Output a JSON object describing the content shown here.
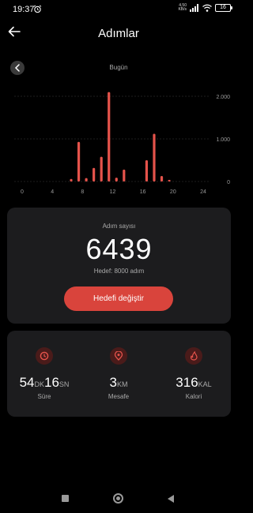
{
  "status_bar": {
    "time": "19:37",
    "net_speed": "4,50 KB/s",
    "battery": "16"
  },
  "header": {
    "title": "Adımlar"
  },
  "chart_nav": {
    "day_label": "Bugün"
  },
  "chart_data": {
    "type": "bar",
    "title": "",
    "x": [
      6,
      7,
      8,
      9,
      10,
      11,
      12,
      13,
      16,
      17,
      18,
      19
    ],
    "values": [
      60,
      930,
      80,
      320,
      580,
      2100,
      90,
      280,
      500,
      1120,
      130,
      40
    ],
    "x_ticks": [
      "0",
      "4",
      "8",
      "12",
      "16",
      "20",
      "24"
    ],
    "y_ticks": [
      "2.000",
      "1.000",
      "0"
    ],
    "xlim": [
      0,
      24
    ],
    "ylim": [
      0,
      2000
    ],
    "bar_color": "#e5534b",
    "grid": "horizontal"
  },
  "steps_card": {
    "label": "Adım sayısı",
    "value": "6439",
    "goal": "Hedef: 8000 adım",
    "button": "Hedefi değiştir"
  },
  "stats": {
    "duration": {
      "min": "54",
      "min_unit": "DK",
      "sec": "16",
      "sec_unit": "SN",
      "label": "Süre",
      "icon": "clock-icon"
    },
    "distance": {
      "value": "3",
      "unit": "KM",
      "label": "Mesafe",
      "icon": "location-pin-icon"
    },
    "calories": {
      "value": "316",
      "unit": "KAL",
      "label": "Kalori",
      "icon": "flame-icon"
    }
  },
  "colors": {
    "accent": "#d9443c",
    "card_bg": "#1c1c1e",
    "icon_bg": "#4a1b1a"
  }
}
